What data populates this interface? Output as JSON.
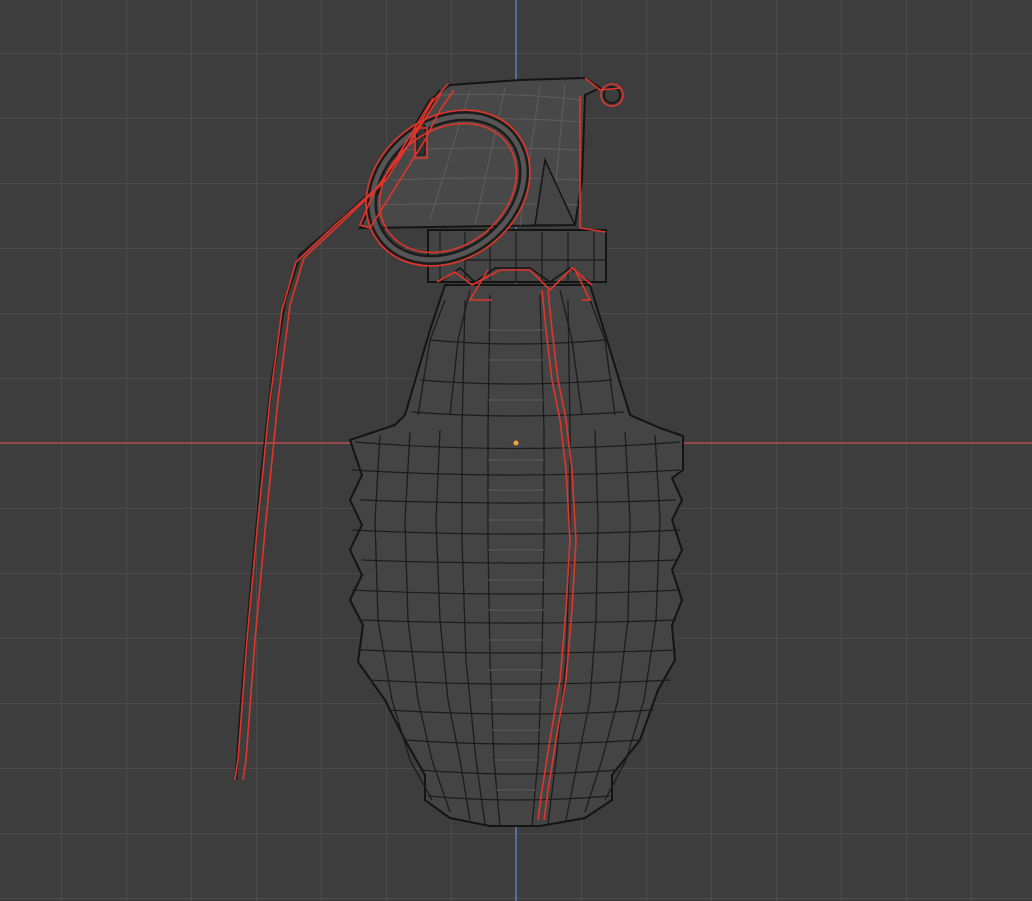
{
  "viewport": {
    "background": "#3d3d3d",
    "grid_color": "#4a4a4a",
    "x_axis_color": "#c94c4c",
    "y_axis_color": "#5b8dd0",
    "origin_color": "#f2a33a"
  },
  "model": {
    "name_icon": "grenade-mesh",
    "wire_color": "#1a1a1a",
    "edge_color": "#5a5a5a",
    "selection_color": "#e0352b",
    "fill_color": "#444444"
  }
}
